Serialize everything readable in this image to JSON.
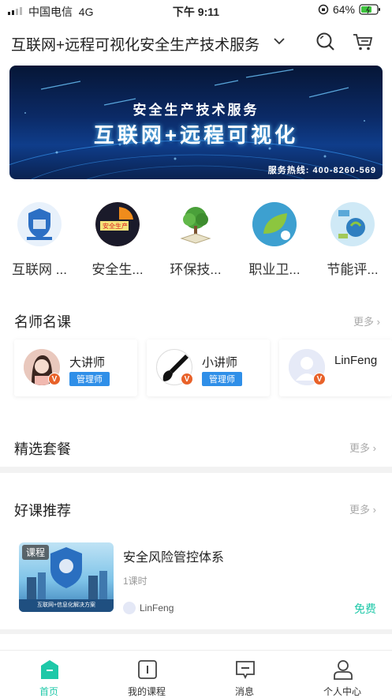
{
  "status_bar": {
    "carrier": "中国电信",
    "network": "4G",
    "time": "下午 9:11",
    "battery": "64%"
  },
  "header": {
    "title": "互联网+远程可视化安全生产技术服务"
  },
  "banner": {
    "line1": "安全生产技术服务",
    "line2": "互联网+远程可视化",
    "hotline": "服务热线: 400-8260-569"
  },
  "categories": [
    {
      "label": "互联网 ..."
    },
    {
      "label": "安全生..."
    },
    {
      "label": "环保技..."
    },
    {
      "label": "职业卫..."
    },
    {
      "label": "节能评..."
    }
  ],
  "teachers_section": {
    "title": "名师名课",
    "more": "更多"
  },
  "teachers": [
    {
      "name": "大讲师",
      "tag": "管理师",
      "badge": "V"
    },
    {
      "name": "小讲师",
      "tag": "管理师",
      "badge": "V"
    },
    {
      "name": "LinFeng",
      "badge": "V"
    }
  ],
  "packages_section": {
    "title": "精选套餐",
    "more": "更多"
  },
  "recommend_section": {
    "title": "好课推荐",
    "more": "更多"
  },
  "course": {
    "tag": "课程",
    "title": "安全风险管控体系",
    "lessons": "1课时",
    "author": "LinFeng",
    "price": "免费",
    "image_caption": "互联网+信息化解决方案"
  },
  "tabbar": [
    {
      "label": "首页",
      "icon": "home-icon",
      "active": true
    },
    {
      "label": "我的课程",
      "icon": "course-icon",
      "active": false
    },
    {
      "label": "消息",
      "icon": "message-icon",
      "active": false
    },
    {
      "label": "个人中心",
      "icon": "profile-icon",
      "active": false
    }
  ],
  "colors": {
    "accent": "#1ec8a8",
    "tag_blue": "#2f8fe8",
    "badge_orange": "#e8622a"
  }
}
